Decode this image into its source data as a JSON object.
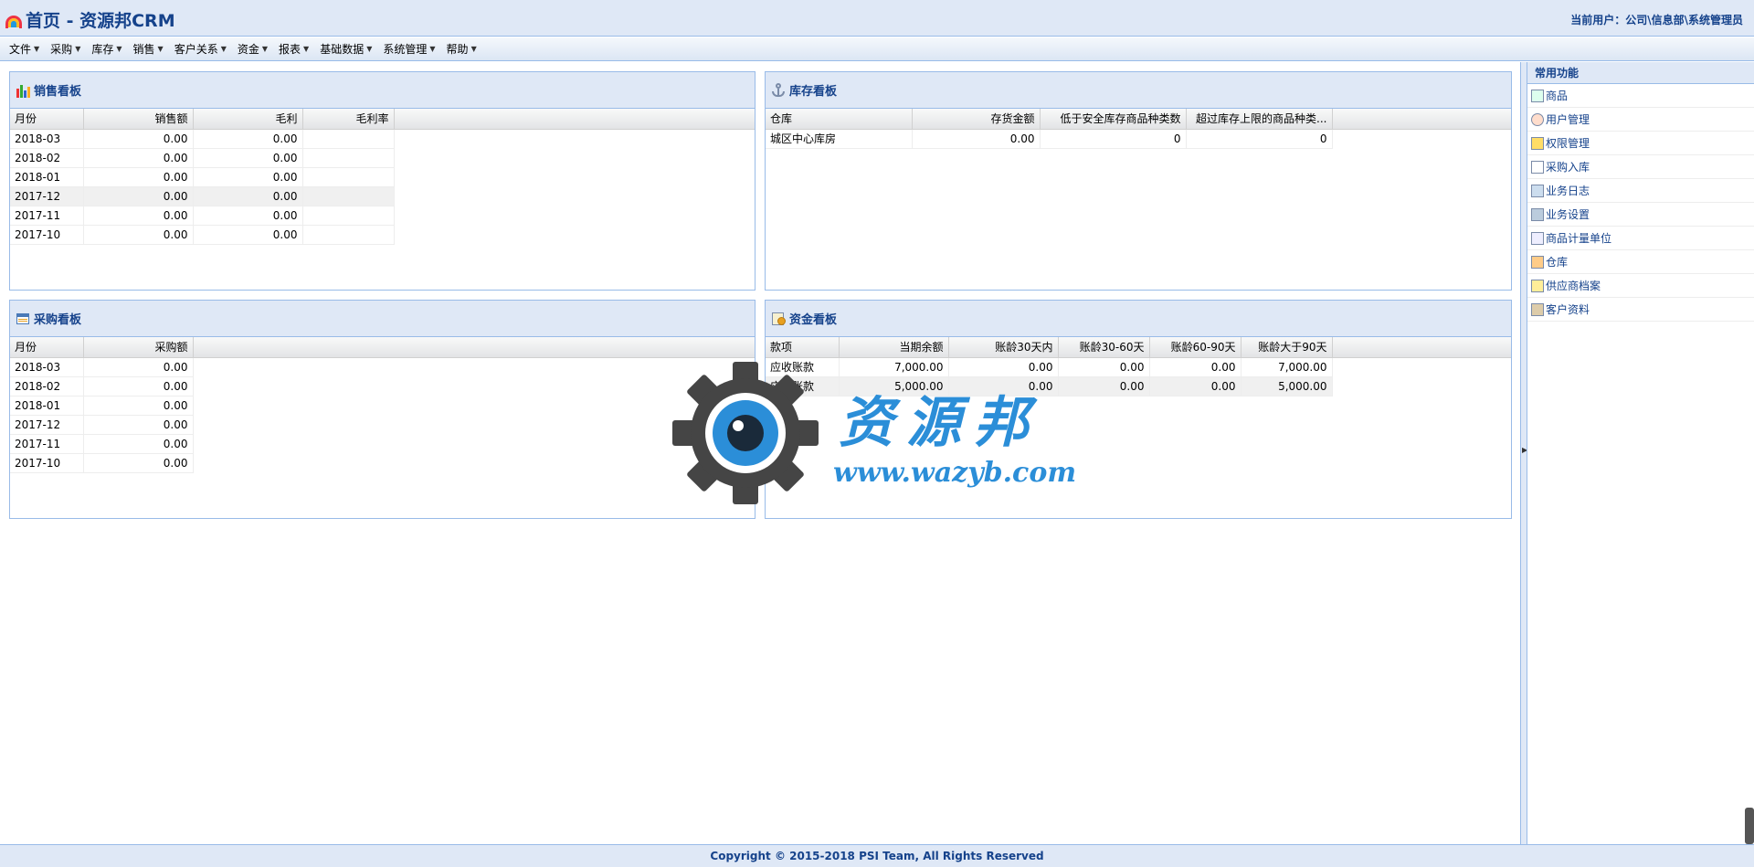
{
  "header": {
    "title": "首页 - 资源邦CRM",
    "user_label": "当前用户：公司\\信息部\\系统管理员"
  },
  "menu": [
    {
      "label": "文件"
    },
    {
      "label": "采购"
    },
    {
      "label": "库存"
    },
    {
      "label": "销售"
    },
    {
      "label": "客户关系"
    },
    {
      "label": "资金"
    },
    {
      "label": "报表"
    },
    {
      "label": "基础数据"
    },
    {
      "label": "系统管理"
    },
    {
      "label": "帮助"
    }
  ],
  "sales": {
    "title": "销售看板",
    "columns": [
      "月份",
      "销售额",
      "毛利",
      "毛利率"
    ],
    "rows": [
      [
        "2018-03",
        "0.00",
        "0.00",
        ""
      ],
      [
        "2018-02",
        "0.00",
        "0.00",
        ""
      ],
      [
        "2018-01",
        "0.00",
        "0.00",
        ""
      ],
      [
        "2017-12",
        "0.00",
        "0.00",
        ""
      ],
      [
        "2017-11",
        "0.00",
        "0.00",
        ""
      ],
      [
        "2017-10",
        "0.00",
        "0.00",
        ""
      ]
    ]
  },
  "inventory": {
    "title": "库存看板",
    "columns": [
      "仓库",
      "存货金额",
      "低于安全库存商品种类数",
      "超过库存上限的商品种类..."
    ],
    "rows": [
      [
        "城区中心库房",
        "0.00",
        "0",
        "0"
      ]
    ]
  },
  "purchase": {
    "title": "采购看板",
    "columns": [
      "月份",
      "采购额"
    ],
    "rows": [
      [
        "2018-03",
        "0.00"
      ],
      [
        "2018-02",
        "0.00"
      ],
      [
        "2018-01",
        "0.00"
      ],
      [
        "2017-12",
        "0.00"
      ],
      [
        "2017-11",
        "0.00"
      ],
      [
        "2017-10",
        "0.00"
      ]
    ]
  },
  "funds": {
    "title": "资金看板",
    "columns": [
      "款项",
      "当期余额",
      "账龄30天内",
      "账龄30-60天",
      "账龄60-90天",
      "账龄大于90天"
    ],
    "rows": [
      [
        "应收账款",
        "7,000.00",
        "0.00",
        "0.00",
        "0.00",
        "7,000.00"
      ],
      [
        "应付账款",
        "5,000.00",
        "0.00",
        "0.00",
        "0.00",
        "5,000.00"
      ]
    ]
  },
  "sidebar": {
    "title": "常用功能",
    "items": [
      {
        "label": "商品",
        "icon": "goods-icon"
      },
      {
        "label": "用户管理",
        "icon": "users-icon"
      },
      {
        "label": "权限管理",
        "icon": "lock-icon"
      },
      {
        "label": "采购入库",
        "icon": "purchase-in-icon"
      },
      {
        "label": "业务日志",
        "icon": "log-icon"
      },
      {
        "label": "业务设置",
        "icon": "settings-icon"
      },
      {
        "label": "商品计量单位",
        "icon": "unit-icon"
      },
      {
        "label": "仓库",
        "icon": "warehouse-icon"
      },
      {
        "label": "供应商档案",
        "icon": "supplier-icon"
      },
      {
        "label": "客户资料",
        "icon": "customer-icon"
      }
    ]
  },
  "watermark": {
    "brand": "资源邦",
    "url": "www.wazyb.com"
  },
  "footer": {
    "copyright": "Copyright © 2015-2018 PSI Team, All Rights Reserved"
  },
  "colors": {
    "header_bg": "#dfe8f6",
    "border": "#99bbe8",
    "title_text": "#15428b",
    "watermark_blue": "#2b8ed8"
  }
}
